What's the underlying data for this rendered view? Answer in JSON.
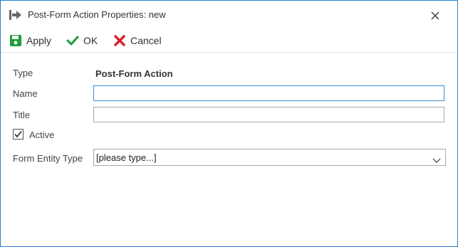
{
  "window": {
    "title": "Post-Form Action Properties: new",
    "icons": {
      "title": "exit-arrow-icon",
      "close": "close-icon"
    },
    "accent_color": "#1f7fd4"
  },
  "toolbar": {
    "apply_label": "Apply",
    "ok_label": "OK",
    "cancel_label": "Cancel",
    "icons": {
      "apply": "save-icon",
      "ok": "checkmark-icon",
      "cancel": "x-icon"
    },
    "colors": {
      "apply": "#1e9c3a",
      "ok": "#1e9c3a",
      "cancel": "#d8232a"
    }
  },
  "form": {
    "type_label": "Type",
    "type_value": "Post-Form Action",
    "name_label": "Name",
    "name_value": "",
    "title_label": "Title",
    "title_value": "",
    "active_label": "Active",
    "active_checked": true,
    "form_entity_type_label": "Form Entity Type",
    "form_entity_type_value": "[please type...]"
  }
}
